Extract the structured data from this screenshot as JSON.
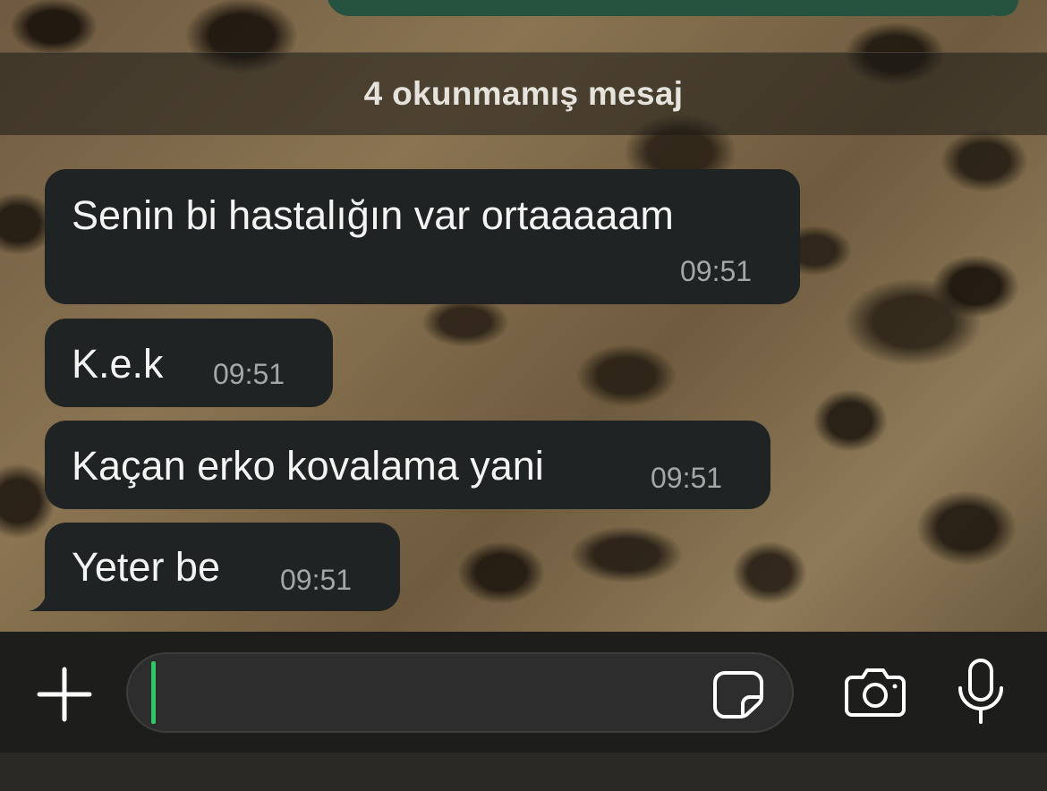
{
  "chat": {
    "unread_label": "4 okunmamış mesaj",
    "messages": [
      {
        "text": "Senin bi hastalığın var ortaaaaam",
        "time": "09:51"
      },
      {
        "text": "K.e.k",
        "time": "09:51"
      },
      {
        "text": "Kaçan erko kovalama yani",
        "time": "09:51"
      },
      {
        "text": "Yeter be",
        "time": "09:51"
      }
    ]
  },
  "composer": {
    "input_value": "",
    "icons": {
      "attach": "plus-icon",
      "sticker": "sticker-icon",
      "camera": "camera-icon",
      "voice": "microphone-icon"
    }
  },
  "colors": {
    "incoming_bubble": "#202323",
    "outgoing_bubble": "#25533f",
    "caret": "#2fc767",
    "timestamp": "#a5a7a7"
  }
}
